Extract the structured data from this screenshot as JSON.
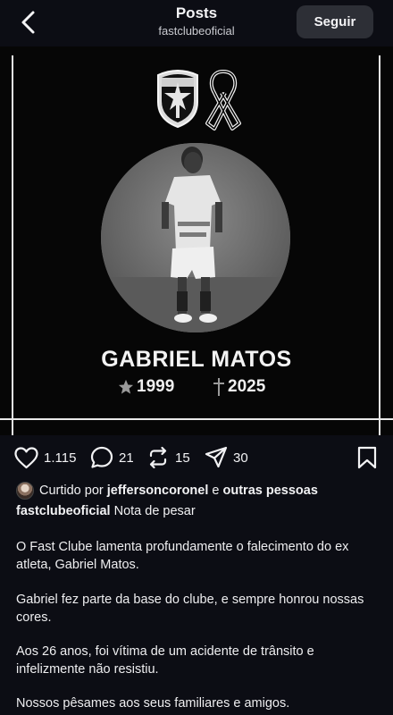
{
  "header": {
    "title": "Posts",
    "username": "fastclubeoficial",
    "follow_label": "Seguir"
  },
  "post_image": {
    "name": "GABRIEL MATOS",
    "birth_year": "1999",
    "death_year": "2025"
  },
  "actions": {
    "likes": "1.115",
    "comments": "21",
    "reposts": "15",
    "shares": "30"
  },
  "liked_by": {
    "prefix": "Curtido por",
    "user": "jeffersoncoronel",
    "conj": "e",
    "others": "outras pessoas"
  },
  "caption": {
    "user": "fastclubeoficial",
    "title": "Nota de pesar",
    "paragraphs": [
      "O Fast Clube lamenta profundamente o falecimento do ex atleta, Gabriel Matos.",
      "Gabriel fez parte da base do clube, e sempre honrou nossas cores.",
      "Aos 26 anos, foi vítima de um acidente de trânsito e infelizmente não resistiu.",
      "Nossos pêsames aos seus familiares e amigos."
    ]
  },
  "colors": {
    "background": "#0c0d14",
    "follow_button": "#2d2f36",
    "image_background": "#060606"
  },
  "icons": [
    "back-arrow-icon",
    "heart-icon",
    "comment-icon",
    "repost-icon",
    "send-icon",
    "bookmark-icon",
    "star-icon",
    "cross-icon"
  ]
}
